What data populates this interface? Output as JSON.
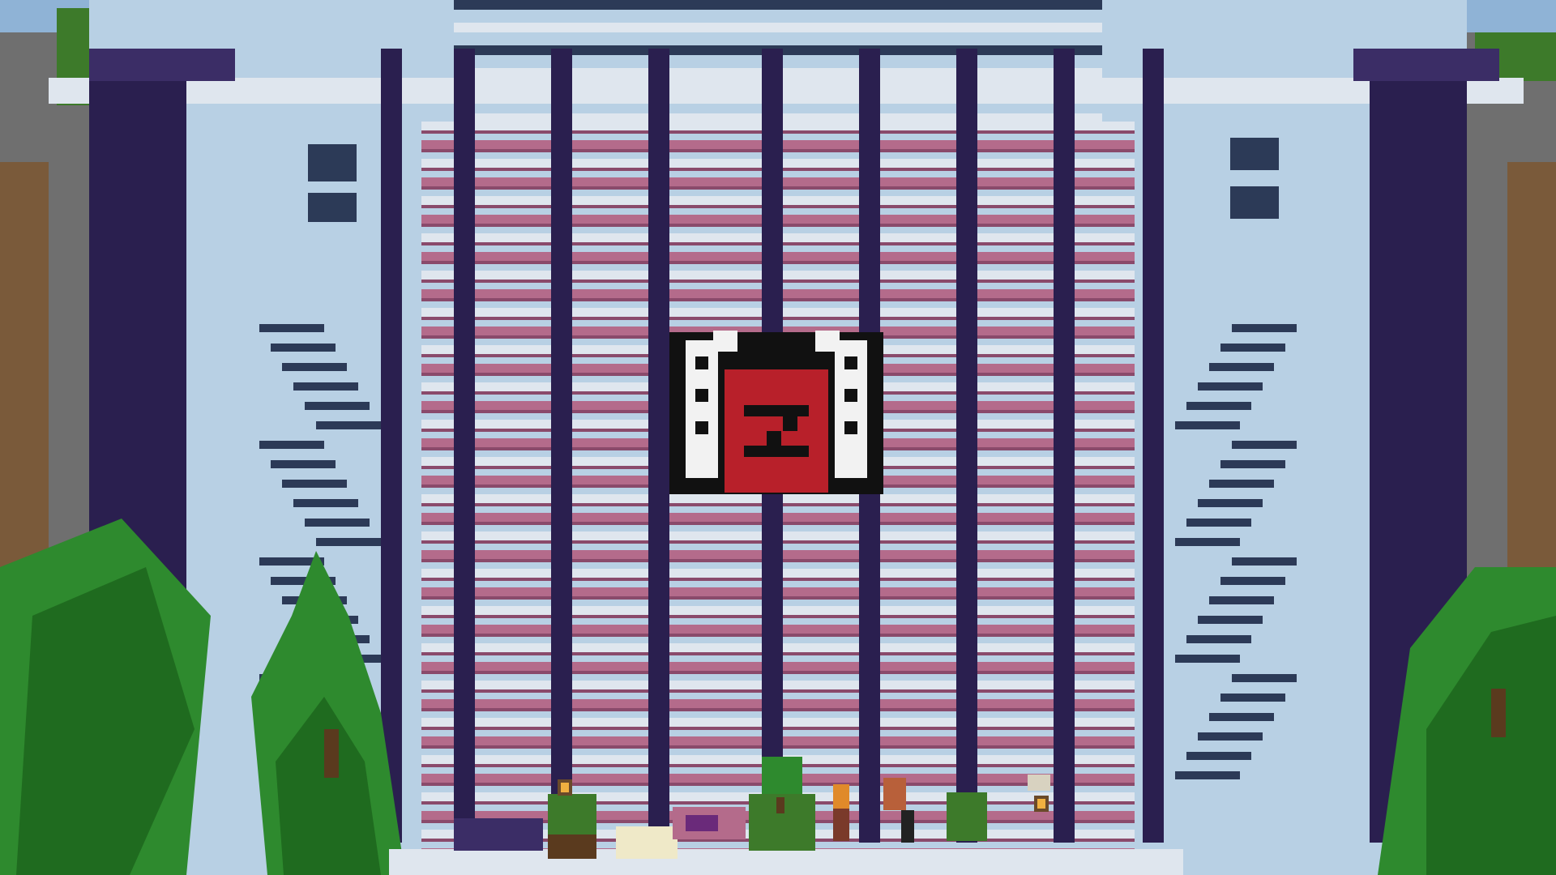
{
  "game": {
    "title": "",
    "scene": "voxel-castle-lobby-facade"
  },
  "colors": {
    "sky": "#8fb3d6",
    "stone_light": "#b8d0e4",
    "stone_mid": "#9fb9d0",
    "stone_dark_stripe": "#2c3a57",
    "pillar_purple": "#2a1f4f",
    "pillar_purple_light": "#3b2d66",
    "concrete_white": "#dfe6ee",
    "stripe_pink": "#b46b8b",
    "stripe_pink_dark": "#8a4a6b",
    "emblem_red": "#b8202a",
    "emblem_black": "#111111",
    "emblem_white": "#f2f2f2",
    "foliage": "#2e8a2e",
    "foliage_dark": "#1f6b1f",
    "trunk": "#5a3a1e",
    "cliff_grey": "#6f6f6f",
    "cliff_dirt": "#7a5a3a"
  },
  "emblem": {
    "letter": "Z",
    "icon": "winged-z-emblem"
  },
  "props": [
    {
      "name": "lantern-left",
      "icon": "lantern-icon"
    },
    {
      "name": "lantern-right",
      "icon": "lantern-icon"
    },
    {
      "name": "grass-block",
      "icon": "grass-block-icon"
    },
    {
      "name": "bed-block",
      "icon": "bed-icon"
    },
    {
      "name": "small-tree",
      "icon": "tree-icon"
    },
    {
      "name": "npc-figure",
      "icon": "npc-icon"
    }
  ]
}
